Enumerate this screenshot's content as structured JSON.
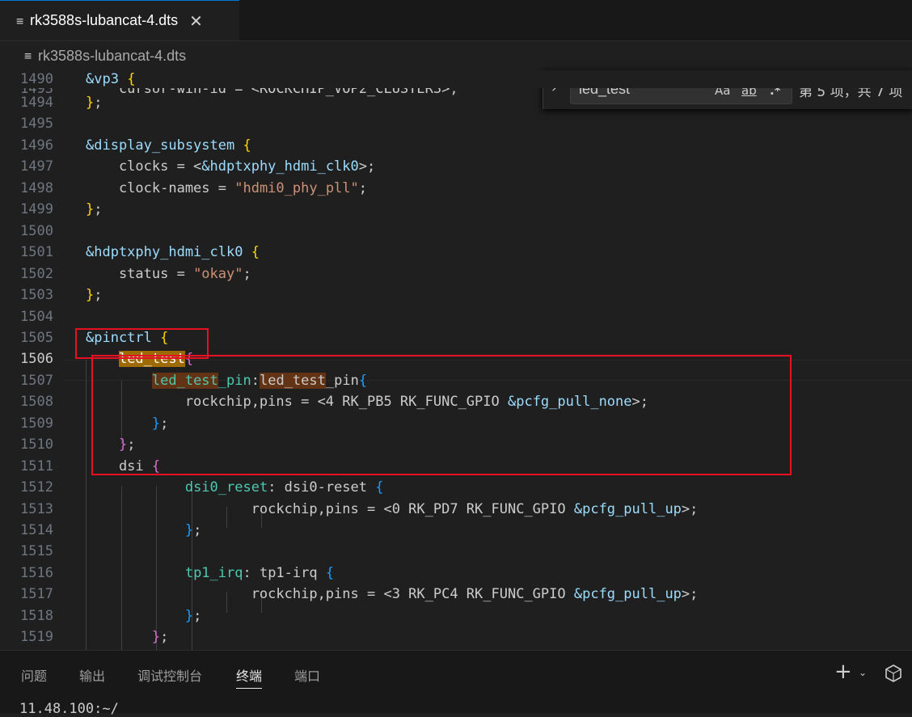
{
  "tab": {
    "file_icon": "≡",
    "filename": "rk3588s-lubancat-4.dts",
    "close": "✕"
  },
  "breadcrumb": {
    "file_icon": "≡",
    "filename": "rk3588s-lubancat-4.dts"
  },
  "find": {
    "toggle": "›",
    "query": "led_test",
    "match_case": "Aa",
    "whole_word": "ab",
    "regex": ".*",
    "count": "第 5 项，共 7 项"
  },
  "lines": [
    {
      "n": "1490",
      "t": [
        {
          "c": "c-ref",
          "s": "&vp3"
        },
        {
          "s": " "
        },
        {
          "c": "c-b1",
          "s": "{"
        }
      ]
    },
    {
      "n": "1493",
      "t": [
        {
          "s": "    cursor-win-id = <ROCKCHIP_VOP2_CLUSTER3>;"
        }
      ]
    },
    {
      "n": "1494",
      "t": [
        {
          "c": "c-b1",
          "s": "}"
        },
        {
          "s": ";"
        }
      ]
    },
    {
      "n": "1495",
      "t": []
    },
    {
      "n": "1496",
      "t": [
        {
          "c": "c-ref",
          "s": "&display_subsystem"
        },
        {
          "s": " "
        },
        {
          "c": "c-b1",
          "s": "{"
        }
      ]
    },
    {
      "n": "1497",
      "t": [
        {
          "s": "    clocks = <"
        },
        {
          "c": "c-ref",
          "s": "&hdptxphy_hdmi_clk0"
        },
        {
          "s": ">;"
        }
      ]
    },
    {
      "n": "1498",
      "t": [
        {
          "s": "    clock-names = "
        },
        {
          "c": "c-str",
          "s": "\"hdmi0_phy_pll\""
        },
        {
          "s": ";"
        }
      ]
    },
    {
      "n": "1499",
      "t": [
        {
          "c": "c-b1",
          "s": "}"
        },
        {
          "s": ";"
        }
      ]
    },
    {
      "n": "1500",
      "t": []
    },
    {
      "n": "1501",
      "t": [
        {
          "c": "c-ref",
          "s": "&hdptxphy_hdmi_clk0"
        },
        {
          "s": " "
        },
        {
          "c": "c-b1",
          "s": "{"
        }
      ]
    },
    {
      "n": "1502",
      "t": [
        {
          "s": "    status = "
        },
        {
          "c": "c-str",
          "s": "\"okay\""
        },
        {
          "s": ";"
        }
      ]
    },
    {
      "n": "1503",
      "t": [
        {
          "c": "c-b1",
          "s": "}"
        },
        {
          "s": ";"
        }
      ]
    },
    {
      "n": "1504",
      "t": []
    },
    {
      "n": "1505",
      "t": [
        {
          "c": "c-ref",
          "s": "&pinctrl"
        },
        {
          "s": " "
        },
        {
          "c": "c-b1",
          "s": "{"
        }
      ]
    },
    {
      "n": "1506",
      "t": [
        {
          "s": "    "
        },
        {
          "c": "c-label hl-cur",
          "s": "led_test"
        },
        {
          "c": "c-b2",
          "s": "{"
        }
      ]
    },
    {
      "n": "1507",
      "t": [
        {
          "s": "        "
        },
        {
          "c": "c-label hl-oth",
          "s": "led_test"
        },
        {
          "c": "c-label",
          "s": "_pin"
        },
        {
          "s": ":"
        },
        {
          "c": "hl-oth",
          "s": "led_test"
        },
        {
          "s": "_pin"
        },
        {
          "c": "c-b3",
          "s": "{"
        }
      ]
    },
    {
      "n": "1508",
      "t": [
        {
          "s": "            rockchip,pins = <4 RK_PB5 RK_FUNC_GPIO "
        },
        {
          "c": "c-ref",
          "s": "&pcfg_pull_none"
        },
        {
          "s": ">;"
        }
      ]
    },
    {
      "n": "1509",
      "t": [
        {
          "s": "        "
        },
        {
          "c": "c-b3",
          "s": "}"
        },
        {
          "s": ";"
        }
      ]
    },
    {
      "n": "1510",
      "t": [
        {
          "s": "    "
        },
        {
          "c": "c-b2",
          "s": "}"
        },
        {
          "s": ";"
        }
      ]
    },
    {
      "n": "1511",
      "t": [
        {
          "s": "    dsi "
        },
        {
          "c": "c-b2",
          "s": "{"
        }
      ]
    },
    {
      "n": "1512",
      "t": [
        {
          "s": "            "
        },
        {
          "c": "c-label",
          "s": "dsi0_reset"
        },
        {
          "s": ": dsi0-reset "
        },
        {
          "c": "c-b3",
          "s": "{"
        }
      ]
    },
    {
      "n": "1513",
      "t": [
        {
          "s": "                    rockchip,pins = <0 RK_PD7 RK_FUNC_GPIO "
        },
        {
          "c": "c-ref",
          "s": "&pcfg_pull_up"
        },
        {
          "s": ">;"
        }
      ]
    },
    {
      "n": "1514",
      "t": [
        {
          "s": "            "
        },
        {
          "c": "c-b3",
          "s": "}"
        },
        {
          "s": ";"
        }
      ]
    },
    {
      "n": "1515",
      "t": []
    },
    {
      "n": "1516",
      "t": [
        {
          "s": "            "
        },
        {
          "c": "c-label",
          "s": "tp1_irq"
        },
        {
          "s": ": tp1-irq "
        },
        {
          "c": "c-b3",
          "s": "{"
        }
      ]
    },
    {
      "n": "1517",
      "t": [
        {
          "s": "                    rockchip,pins = <3 RK_PC4 RK_FUNC_GPIO "
        },
        {
          "c": "c-ref",
          "s": "&pcfg_pull_up"
        },
        {
          "s": ">;"
        }
      ]
    },
    {
      "n": "1518",
      "t": [
        {
          "s": "            "
        },
        {
          "c": "c-b3",
          "s": "}"
        },
        {
          "s": ";"
        }
      ]
    },
    {
      "n": "1519",
      "t": [
        {
          "s": "        "
        },
        {
          "c": "c-b2",
          "s": "}"
        },
        {
          "s": ";"
        }
      ]
    }
  ],
  "panel": {
    "tabs": [
      "问题",
      "输出",
      "调试控制台",
      "终端",
      "端口"
    ],
    "active_tab": "终端",
    "add_icon": "+",
    "dropdown_icon": "⌄",
    "terminal_text": "11.48.100:~/"
  }
}
